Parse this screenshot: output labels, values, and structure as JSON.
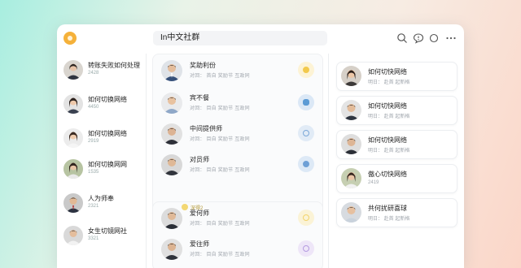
{
  "window": {
    "title": "In中文社群"
  },
  "toolbar": {
    "icons": [
      "search-icon",
      "chat-icon",
      "refresh-icon",
      "more-icon"
    ]
  },
  "sidebar": {
    "items": [
      {
        "name": "转账失败如何处理",
        "count": "2428"
      },
      {
        "name": "如何切换网络",
        "count": "4450"
      },
      {
        "name": "如何切换网络",
        "count": "2919"
      },
      {
        "name": "如何切换网网",
        "count": "1535"
      },
      {
        "name": "人为师奉",
        "count": "2321"
      },
      {
        "name": "女生切镜网社",
        "count": "3321"
      }
    ]
  },
  "middle": {
    "items": [
      {
        "name": "奖助利份",
        "sub": "对回：   首自   奖励节   互政同",
        "bulb_color": "#f2c94c"
      },
      {
        "name": "宾不餐",
        "sub": "对回：   目自   奖励节   互政同",
        "bulb_color": "#5b9bd5"
      },
      {
        "name": "中间提供师",
        "sub": "对回：   目自   奖励节   互政同",
        "bulb_color": "#7aa7d8"
      },
      {
        "name": "对员师",
        "sub": "对回：   目自   奖励节   互政同",
        "bulb_color": "#6fa0d6"
      },
      {
        "name": "爱何师",
        "sub": "对回：   目自   奖励节   互政同",
        "bulb_color": "#f2d36b"
      },
      {
        "name": "爱往师",
        "sub": "对回：   目自   奖励节   互政同",
        "bulb_color": "#b59be0"
      }
    ],
    "tag": "深得2"
  },
  "right": {
    "items": [
      {
        "name": "如何切快网络",
        "sub": "明日：   赴首   起新格"
      },
      {
        "name": "如何切快网络",
        "sub": "明日：   赴首   起新格"
      },
      {
        "name": "如何切快网络",
        "sub": "明日：   赴首   起新格"
      },
      {
        "name": "傲心切快网络",
        "sub": "2419"
      },
      {
        "name": "共何扰研喜球",
        "sub": "明日：   赴首   起新格"
      }
    ]
  },
  "colors": {
    "accent": "#f5b13a"
  }
}
